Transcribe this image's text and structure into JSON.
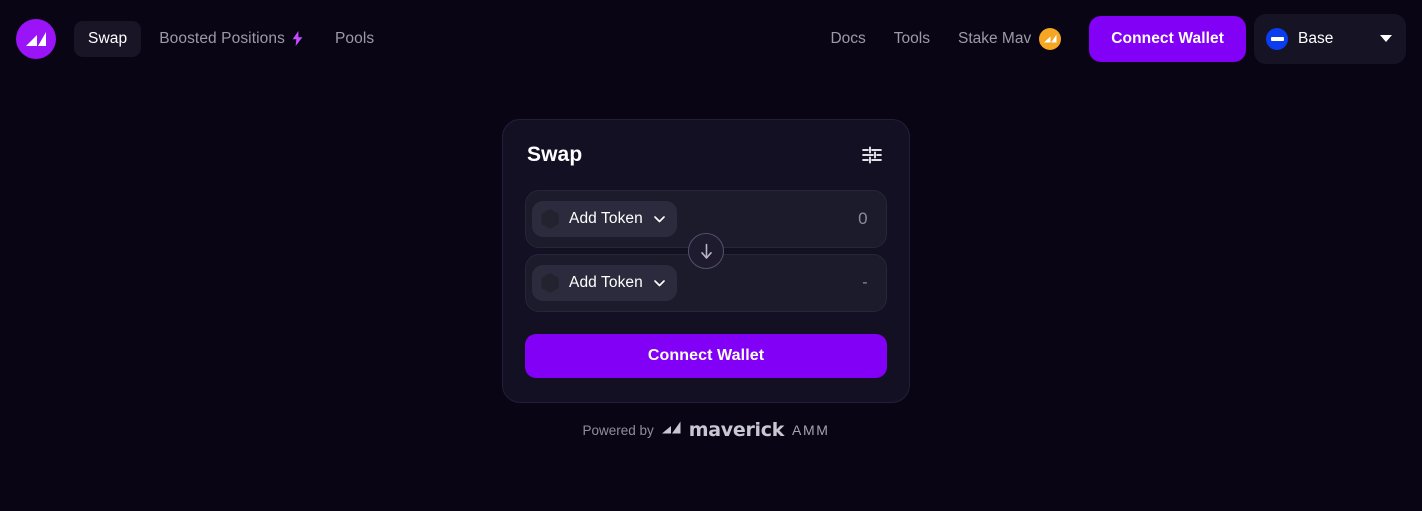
{
  "header": {
    "logo_icon": "maverick-mountain-logo",
    "nav_items": [
      {
        "label": "Swap",
        "active": true,
        "icon": null
      },
      {
        "label": "Boosted Positions",
        "active": false,
        "icon": "lightning-bolt-icon"
      },
      {
        "label": "Pools",
        "active": false,
        "icon": null
      }
    ],
    "links": [
      {
        "label": "Docs",
        "icon": null
      },
      {
        "label": "Tools",
        "icon": null
      },
      {
        "label": "Stake Mav",
        "icon": "mav-coin-icon"
      }
    ],
    "connect_wallet_label": "Connect Wallet",
    "chain": {
      "label": "Base",
      "icon": "base-chain-icon",
      "caret_icon": "caret-down-icon"
    }
  },
  "swap_card": {
    "title": "Swap",
    "settings_icon": "sliders-settings-icon",
    "swap_direction_icon": "arrow-down-icon",
    "from": {
      "token_label": "Add Token",
      "token_icon": "token-placeholder-icon",
      "chevron_icon": "chevron-down-icon",
      "amount": "0"
    },
    "to": {
      "token_label": "Add Token",
      "token_icon": "token-placeholder-icon",
      "chevron_icon": "chevron-down-icon",
      "amount": "-"
    },
    "cta_label": "Connect Wallet"
  },
  "footer": {
    "powered_by": "Powered by",
    "brand_icon": "maverick-mountain-icon",
    "brand": "maverick",
    "product": "AMM"
  },
  "colors": {
    "background": "#0a0515",
    "card_background": "#131024",
    "row_background": "#1b1b2b",
    "accent_purple": "#8200f5",
    "logo_purple": "#9a14f7",
    "mav_gold": "#f5a623",
    "base_blue": "#0a3df0",
    "text_primary": "#ffffff",
    "text_muted": "#9b9aa8"
  }
}
